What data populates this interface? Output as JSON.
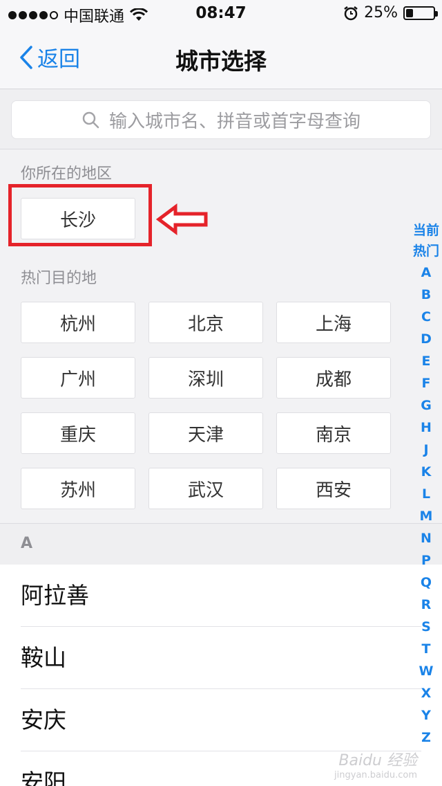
{
  "status": {
    "carrier": "中国联通",
    "time": "08:47",
    "battery": "25%",
    "battery_level": 0.25,
    "signal_icon": "signal-dots-icon",
    "wifi_icon": "wifi-icon",
    "alarm_icon": "alarm-icon"
  },
  "nav": {
    "back_label": "返回",
    "title": "城市选择",
    "accent": "#1a83e8"
  },
  "search": {
    "placeholder": "输入城市名、拼音或首字母查询",
    "icon": "search-icon"
  },
  "location": {
    "label": "你所在的地区",
    "city": "长沙"
  },
  "hot": {
    "label": "热门目的地",
    "cities": [
      "杭州",
      "北京",
      "上海",
      "广州",
      "深圳",
      "成都",
      "重庆",
      "天津",
      "南京",
      "苏州",
      "武汉",
      "西安"
    ]
  },
  "list": {
    "header": "A",
    "items": [
      "阿拉善",
      "鞍山",
      "安庆",
      "安阳"
    ]
  },
  "index": {
    "current": "当前",
    "hot": "热门",
    "letters": [
      "A",
      "B",
      "C",
      "D",
      "E",
      "F",
      "G",
      "H",
      "J",
      "K",
      "L",
      "M",
      "N",
      "P",
      "Q",
      "R",
      "S",
      "T",
      "W",
      "X",
      "Y",
      "Z"
    ]
  },
  "annotation": {
    "highlight_color": "#e5232a"
  },
  "watermark": {
    "brand": "Baidu 经验",
    "url": "jingyan.baidu.com"
  }
}
